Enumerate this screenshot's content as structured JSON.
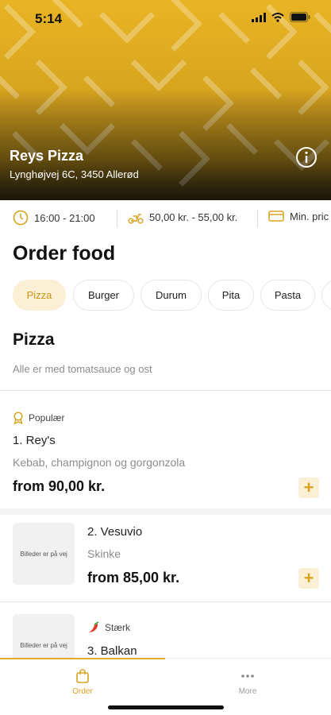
{
  "status_bar": {
    "time": "5:14"
  },
  "restaurant": {
    "name": "Reys Pizza",
    "address": "Lynghøjvej 6C, 3450 Allerød"
  },
  "info_strip": {
    "opening_hours": "16:00 - 21:00",
    "delivery_fee": "50,00 kr. - 55,00 kr.",
    "min_price": "Min. pric"
  },
  "page_title": "Order food",
  "categories": [
    {
      "label": "Pizza",
      "active": true
    },
    {
      "label": "Burger",
      "active": false
    },
    {
      "label": "Durum",
      "active": false
    },
    {
      "label": "Pita",
      "active": false
    },
    {
      "label": "Pasta",
      "active": false
    }
  ],
  "section": {
    "title": "Pizza",
    "subtitle": "Alle er med tomatsauce og ost"
  },
  "products": [
    {
      "badge": "Populær",
      "badge_icon": "award-icon",
      "name": "1. Rey's",
      "description": "Kebab, champignon og gorgonzola",
      "price": "from 90,00 kr."
    },
    {
      "image_placeholder": "Billeder er på vej",
      "name": "2. Vesuvio",
      "description": "Skinke",
      "price": "from 85,00 kr."
    },
    {
      "image_placeholder": "Billeder er på vej",
      "badge": "Stærk",
      "badge_icon": "chili-pepper-icon",
      "name": "3. Balkan"
    }
  ],
  "add_label": "+",
  "tabbar": {
    "order_label": "Order",
    "more_label": "More"
  },
  "colors": {
    "accent": "#d9a320",
    "accent_light": "#fbf0d6",
    "hero_yellow": "#e9b424"
  }
}
